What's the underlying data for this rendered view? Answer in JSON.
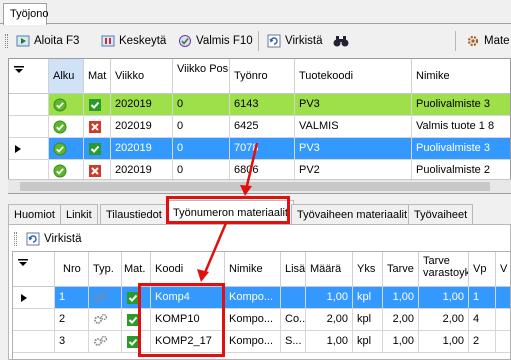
{
  "window": {
    "tab": "Työjono"
  },
  "toolbar": {
    "buttons": [
      {
        "label": "Aloita F3",
        "icon": "play-icon"
      },
      {
        "label": "Keskeytä",
        "icon": "pause-icon"
      },
      {
        "label": "Valmis F10",
        "icon": "finish-icon"
      },
      {
        "label": "Virkistä",
        "icon": "refresh-icon"
      },
      {
        "label": "",
        "icon": "binoculars-icon"
      },
      {
        "label": "Mate",
        "icon": "material-icon"
      }
    ]
  },
  "top_grid": {
    "columns": [
      "",
      "Alku",
      "Mat",
      "Viikko",
      "Viikko Pos",
      "Työnro",
      "Tuotekoodi",
      "Nimike"
    ],
    "rows": [
      {
        "alku": "check",
        "mat": "check",
        "viikko": "202019",
        "pos": "0",
        "tyonro": "6143",
        "koodi": "PV3",
        "nimike": "Puolivalmiste 3",
        "style": "green"
      },
      {
        "alku": "check",
        "mat": "cross",
        "viikko": "202019",
        "pos": "0",
        "tyonro": "6425",
        "koodi": "VALMIS",
        "nimike": "Valmis tuote 1 8",
        "style": ""
      },
      {
        "alku": "check",
        "mat": "check",
        "viikko": "202019",
        "pos": "0",
        "tyonro": "7078",
        "koodi": "PV3",
        "nimike": "Puolivalmiste 3",
        "style": "selected"
      },
      {
        "alku": "check",
        "mat": "cross",
        "viikko": "202019",
        "pos": "0",
        "tyonro": "6806",
        "koodi": "PV2",
        "nimike": "Puolivalmiste 2",
        "style": ""
      }
    ]
  },
  "bottom_tabs": [
    "Huomiot",
    "Linkit",
    "Tilaustiedot",
    "Työnumeron materiaalit",
    "Työvaiheen materiaalit",
    "Työvaiheet"
  ],
  "bottom_toolbar": {
    "refresh_label": "Virkistä"
  },
  "bottom_grid": {
    "columns": [
      "",
      "Nro",
      "Typ.",
      "Mat.",
      "Koodi",
      "Nimike",
      "Lisär",
      "Määrä",
      "Yks",
      "Tarve",
      "Tarve varastoyk",
      "Vp",
      "V"
    ],
    "rows": [
      {
        "nro": "1",
        "koodi": "Komp4",
        "nimike": "Kompo...",
        "lisa": "",
        "maara": "1,00",
        "yks": "kpl",
        "tarve": "1,00",
        "tarve_var": "1,00",
        "vp": "1",
        "style": "selected"
      },
      {
        "nro": "2",
        "koodi": "KOMP10",
        "nimike": "Kompo...",
        "lisa": "Co...",
        "maara": "2,00",
        "yks": "kpl",
        "tarve": "2,00",
        "tarve_var": "2,00",
        "vp": "4",
        "style": ""
      },
      {
        "nro": "3",
        "koodi": "KOMP2_17",
        "nimike": "Kompo...",
        "lisa": "S...",
        "maara": "1,00",
        "yks": "kpl",
        "tarve": "1,00",
        "tarve_var": "1,00",
        "vp": "2",
        "style": ""
      }
    ]
  },
  "colors": {
    "selected": "#3399ff",
    "green_row": "#9ee04a",
    "annotation": "#e01010"
  }
}
